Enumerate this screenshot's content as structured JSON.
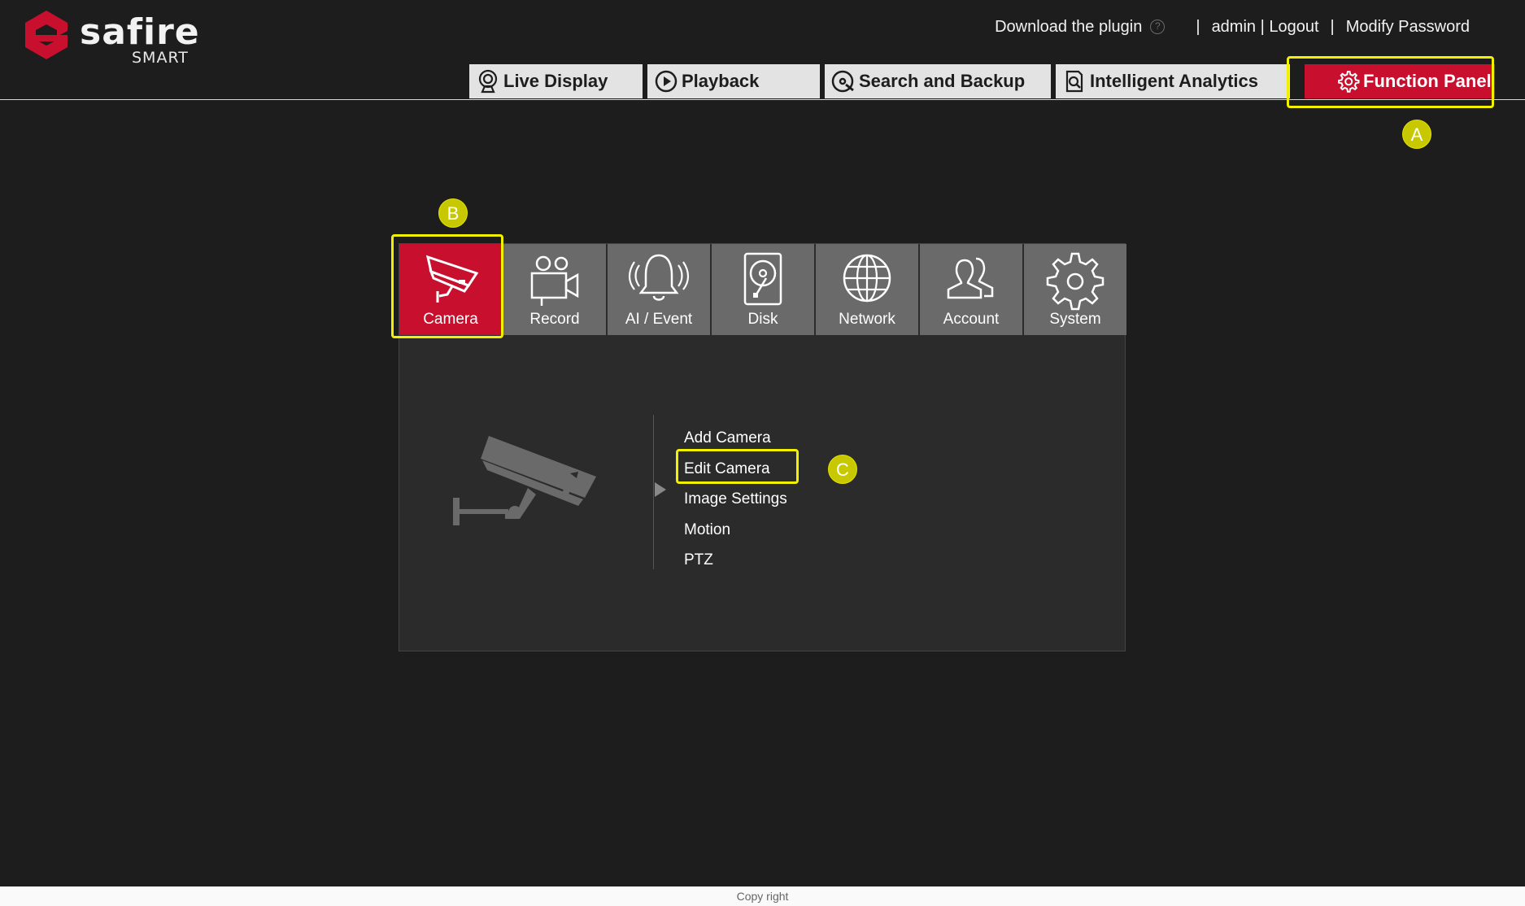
{
  "brand": {
    "name": "safire",
    "sub": "SMART",
    "accent": "#c8102e"
  },
  "toplinks": {
    "download": "Download the plugin",
    "help_icon": "?",
    "sep1": "|",
    "admin": "admin | Logout",
    "sep2": "|",
    "modify": "Modify Password"
  },
  "nav": {
    "tabs": [
      {
        "label": "Live Display",
        "icon": "webcam-icon"
      },
      {
        "label": "Playback",
        "icon": "play-circle-icon"
      },
      {
        "label": "Search and Backup",
        "icon": "search-disc-icon"
      },
      {
        "label": "Intelligent Analytics",
        "icon": "document-search-icon"
      },
      {
        "label": "Function Panel",
        "icon": "gear-icon",
        "active": true
      }
    ]
  },
  "annotations": {
    "a": "A",
    "b": "B",
    "c": "C",
    "highlight_color": "#f0f000"
  },
  "tiles": [
    {
      "label": "Camera",
      "icon": "cctv-camera-icon",
      "active": true
    },
    {
      "label": "Record",
      "icon": "video-camera-icon"
    },
    {
      "label": "AI / Event",
      "icon": "alarm-bell-icon"
    },
    {
      "label": "Disk",
      "icon": "hard-disk-icon"
    },
    {
      "label": "Network",
      "icon": "globe-icon"
    },
    {
      "label": "Account",
      "icon": "users-icon"
    },
    {
      "label": "System",
      "icon": "gear-icon"
    }
  ],
  "submenu": {
    "items": [
      "Add Camera",
      "Edit Camera",
      "Image Settings",
      "Motion",
      "PTZ"
    ]
  },
  "footer": {
    "text": "Copy right"
  }
}
